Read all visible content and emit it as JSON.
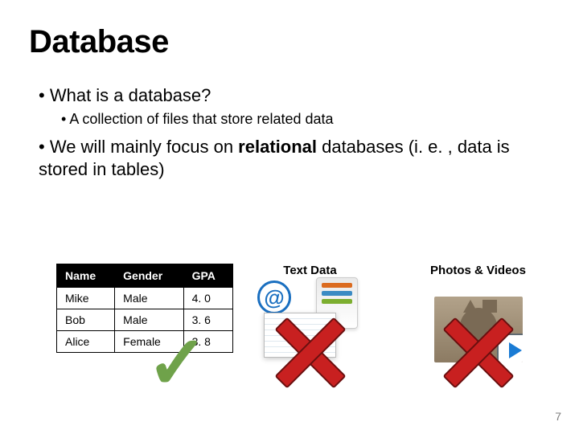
{
  "title": "Database",
  "bullets": {
    "q": "What  is  a  database?",
    "a": "A  collection  of  files  that  store  related  data",
    "focus_pre": "We will mainly  focus on ",
    "focus_bold": "relational",
    "focus_post": " databases  (i. e. , data  is  stored  in  tables)"
  },
  "table": {
    "headers": [
      "Name",
      "Gender",
      "GPA"
    ],
    "rows": [
      [
        "Mike",
        "Male",
        "4. 0"
      ],
      [
        "Bob",
        "Male",
        "3. 6"
      ],
      [
        "Alice",
        "Female",
        "3. 8"
      ]
    ]
  },
  "labels": {
    "text_data": "Text Data",
    "media": "Photos & Videos"
  },
  "page_number": "7"
}
